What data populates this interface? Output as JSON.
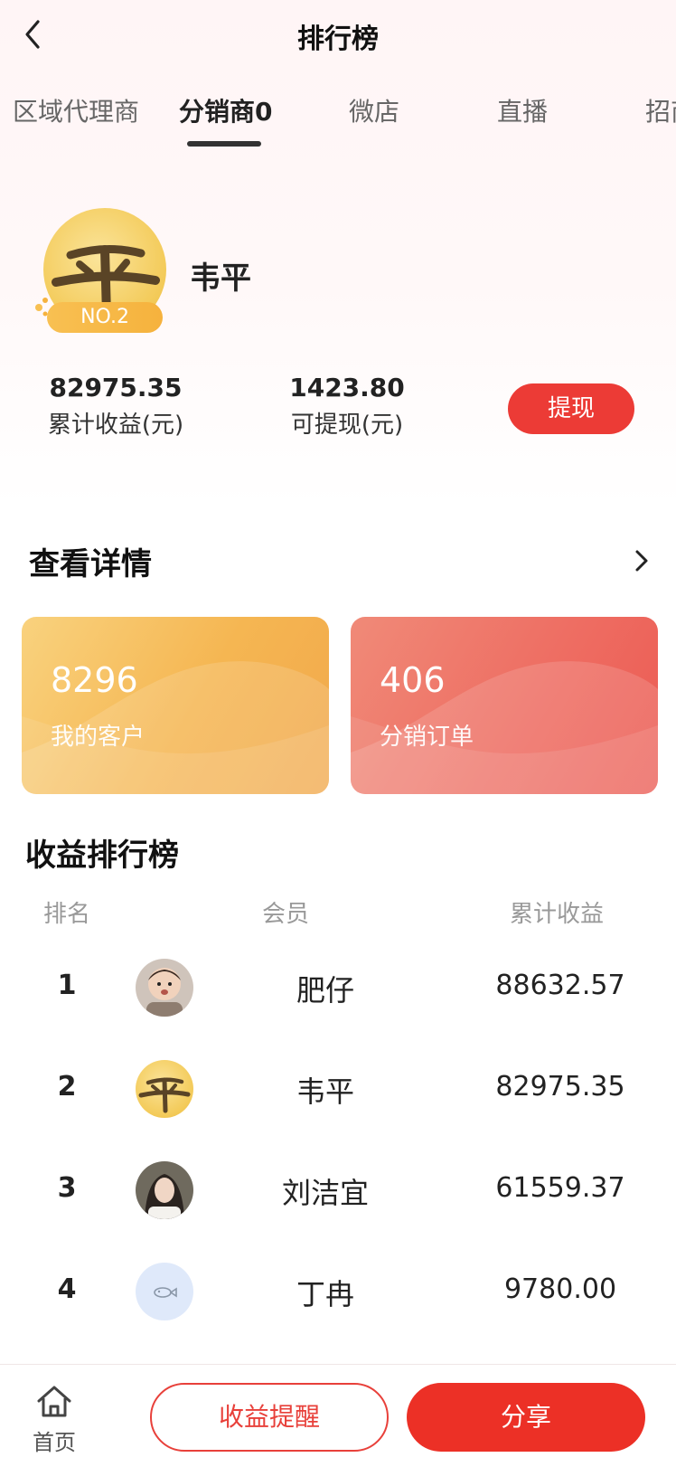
{
  "header": {
    "title": "排行榜",
    "back_icon": "chevron-left-icon"
  },
  "tabs": [
    {
      "label": "区域代理商",
      "active": false
    },
    {
      "label": "分销商0",
      "active": true
    },
    {
      "label": "微店",
      "active": false
    },
    {
      "label": "直播",
      "active": false
    },
    {
      "label": "招商",
      "active": false
    }
  ],
  "profile": {
    "name": "韦平",
    "rank_badge": "NO.2",
    "total_income": {
      "value": "82975.35",
      "label": "累计收益(元)"
    },
    "withdrawable": {
      "value": "1423.80",
      "label": "可提现(元)"
    },
    "withdraw_button": "提现"
  },
  "details": {
    "title": "查看详情",
    "cards": [
      {
        "value": "8296",
        "label": "我的客户"
      },
      {
        "value": "406",
        "label": "分销订单"
      }
    ]
  },
  "ranking": {
    "title": "收益排行榜",
    "columns": [
      "排名",
      "会员",
      "累计收益"
    ],
    "rows": [
      {
        "rank": "1",
        "name": "肥仔",
        "income": "88632.57"
      },
      {
        "rank": "2",
        "name": "韦平",
        "income": "82975.35"
      },
      {
        "rank": "3",
        "name": "刘洁宜",
        "income": "61559.37"
      },
      {
        "rank": "4",
        "name": "丁冉",
        "income": "9780.00"
      }
    ]
  },
  "bottom_bar": {
    "home_label": "首页",
    "remind_button": "收益提醒",
    "share_button": "分享"
  },
  "colors": {
    "accent_red": "#ec3026",
    "card_orange": "#f5b652",
    "card_red": "#ee6e63",
    "badge_gold": "#f6b23d"
  }
}
